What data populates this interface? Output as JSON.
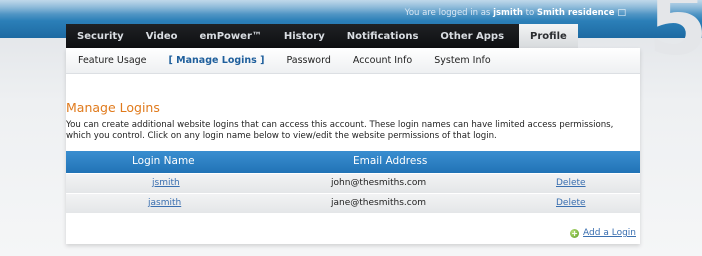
{
  "header": {
    "login_prefix": "You are logged in as ",
    "username": "jsmith",
    "login_middle": " to ",
    "account": "Smith residence",
    "status_symbol": "□",
    "step_number": "5"
  },
  "main_nav": {
    "tabs": [
      {
        "label": "Security"
      },
      {
        "label": "Video"
      },
      {
        "label": "emPower™"
      },
      {
        "label": "History"
      },
      {
        "label": "Notifications"
      },
      {
        "label": "Other Apps"
      },
      {
        "label": "Profile"
      }
    ],
    "active": "Profile"
  },
  "sub_nav": {
    "items": [
      {
        "label": "Feature Usage"
      },
      {
        "label": "[ Manage Logins ]"
      },
      {
        "label": "Password"
      },
      {
        "label": "Account Info"
      },
      {
        "label": "System Info"
      }
    ],
    "active": "[ Manage Logins ]"
  },
  "page": {
    "title": "Manage Logins",
    "description": "You can create additional website logins that can access this account. These login names can have limited access permissions, which you control. Click on any login name below to view/edit the website permissions of that login."
  },
  "table": {
    "columns": [
      "Login Name",
      "Email Address"
    ],
    "rows": [
      {
        "login": "jsmith",
        "email": "john@thesmiths.com",
        "action": "Delete"
      },
      {
        "login": "jasmith",
        "email": "jane@thesmiths.com",
        "action": "Delete"
      }
    ]
  },
  "actions": {
    "add_login": "Add a Login"
  },
  "colors": {
    "accent_orange": "#e07a1c",
    "header_blue": "#2173b6",
    "nav_dark": "#0e0f11",
    "link_blue": "#3a6fb0"
  }
}
